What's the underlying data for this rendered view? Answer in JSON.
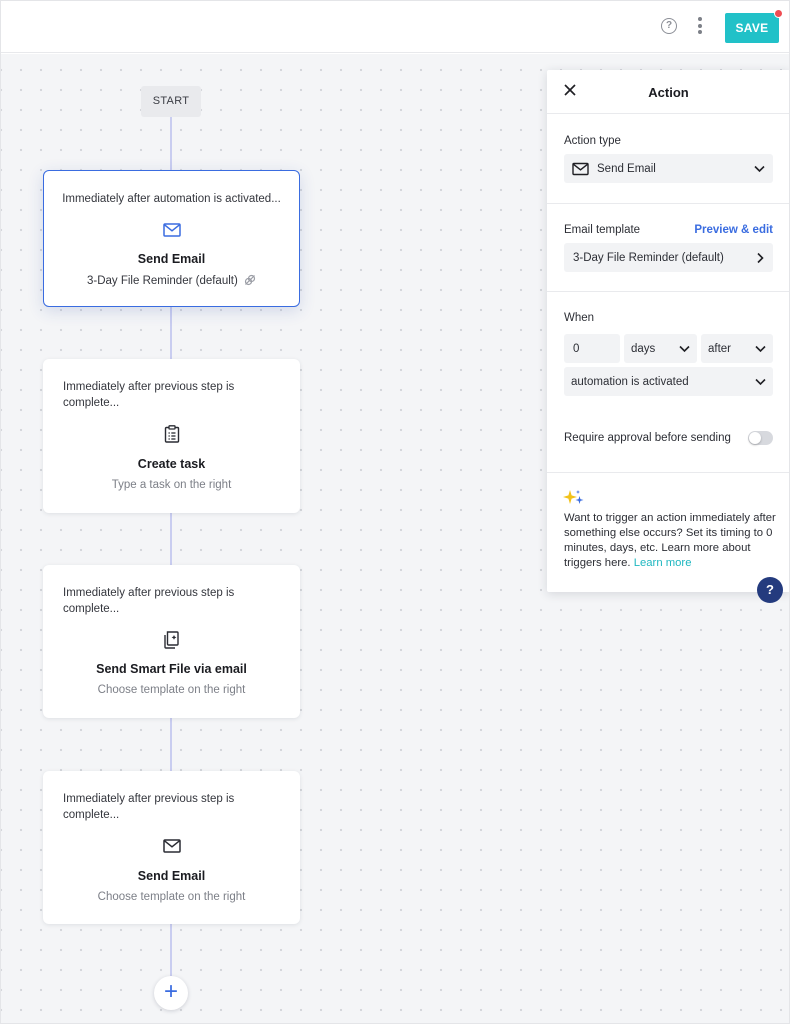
{
  "toolbar": {
    "help_icon": "question-circle-icon",
    "more_icon": "kebab-menu-icon",
    "save_label": "SAVE",
    "save_color": "#21c1c8",
    "unsaved_dot_color": "#ef4c52"
  },
  "flow": {
    "start_label": "START",
    "steps": [
      {
        "trigger": "Immediately after automation is activated...",
        "icon": "envelope-icon",
        "title": "Send Email",
        "subtitle": "3-Day File Reminder (default)",
        "selected": true
      },
      {
        "trigger": "Immediately after previous step is complete...",
        "icon": "clipboard-list-icon",
        "title": "Create task",
        "subtitle": "Type a task on the right",
        "selected": false
      },
      {
        "trigger": "Immediately after previous step is complete...",
        "icon": "smart-file-icon",
        "title": "Send Smart File via email",
        "subtitle": "Choose template on the right",
        "selected": false
      },
      {
        "trigger": "Immediately after previous step is complete...",
        "icon": "envelope-icon",
        "title": "Send Email",
        "subtitle": "Choose template on the right",
        "selected": false
      }
    ],
    "add_label": "+"
  },
  "panel": {
    "title": "Action",
    "action_type_label": "Action type",
    "action_type_value": "Send Email",
    "email_template_label": "Email template",
    "preview_link": "Preview & edit",
    "email_template_value": "3-Day File Reminder (default)",
    "when_label": "When",
    "when_amount": "0",
    "when_unit": "days",
    "when_relation": "after",
    "when_event": "automation is activated",
    "approval_label": "Require approval before sending",
    "approval_enabled": false,
    "tip_text": "Want to trigger an action immediately after something else occurs? Set its timing to 0 minutes, days, etc. Learn more about triggers here.",
    "tip_link": "Learn more"
  },
  "help_fab": "?",
  "colors": {
    "accent_blue": "#3a6ce0",
    "teal": "#21c1c8",
    "dark_navy": "#243b7e"
  }
}
